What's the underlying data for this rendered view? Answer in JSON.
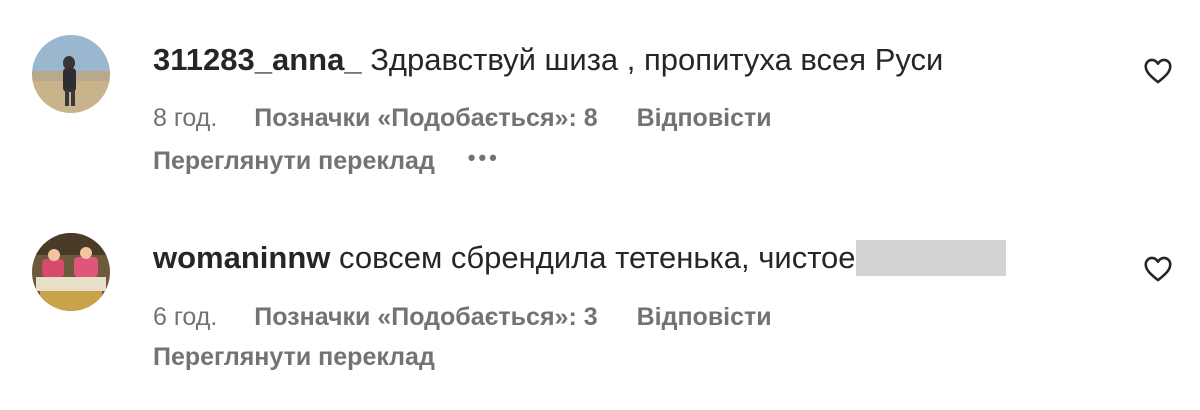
{
  "comments": [
    {
      "username": "311283_anna_",
      "text": "Здравствуй шиза , пропитуха всея Руси",
      "time": "8 год.",
      "likes": "Позначки «Подобається»: 8",
      "reply": "Відповісти",
      "translate": "Переглянути переклад",
      "more": "•••",
      "redacted": false
    },
    {
      "username": "womaninnw",
      "text": "совсем сбрендила тетенька, чистое",
      "time": "6 год.",
      "likes": "Позначки «Подобається»: 3",
      "reply": "Відповісти",
      "translate": "Переглянути переклад",
      "redacted": true
    }
  ],
  "icons": {
    "like": "heart-outline-icon",
    "more": "more-options-icon"
  },
  "colors": {
    "primary_text": "#262626",
    "secondary_text": "#737373",
    "redaction": "#d3d3d3"
  }
}
